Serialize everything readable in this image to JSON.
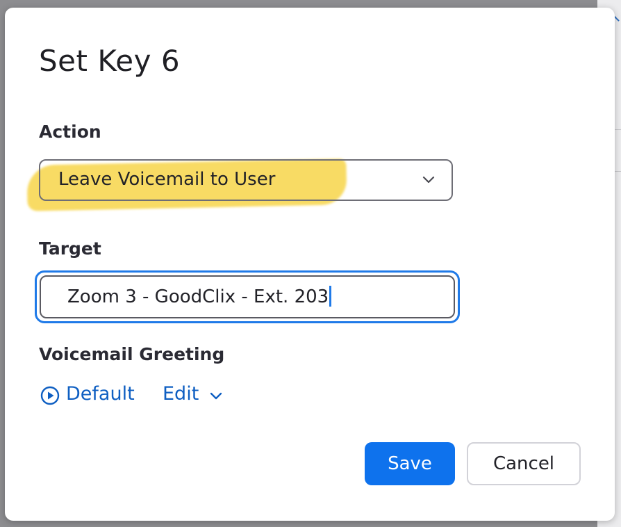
{
  "dialog": {
    "title": "Set Key 6",
    "action": {
      "label": "Action",
      "selected_value": "Leave Voicemail to User",
      "dropdown_icon": "chevron-down-icon"
    },
    "target": {
      "label": "Target",
      "value": "Zoom 3 - GoodClix - Ext. 203"
    },
    "voicemail_greeting": {
      "label": "Voicemail Greeting",
      "play_icon": "play-circle-icon",
      "default_label": "Default",
      "edit_label": "Edit",
      "edit_icon": "chevron-down-icon"
    },
    "buttons": {
      "save_label": "Save",
      "cancel_label": "Cancel"
    }
  },
  "colors": {
    "accent": "#0e72ed",
    "link": "#0f5fc2",
    "highlight": "#f7d54a",
    "focus_ring": "#1f7ae8"
  }
}
